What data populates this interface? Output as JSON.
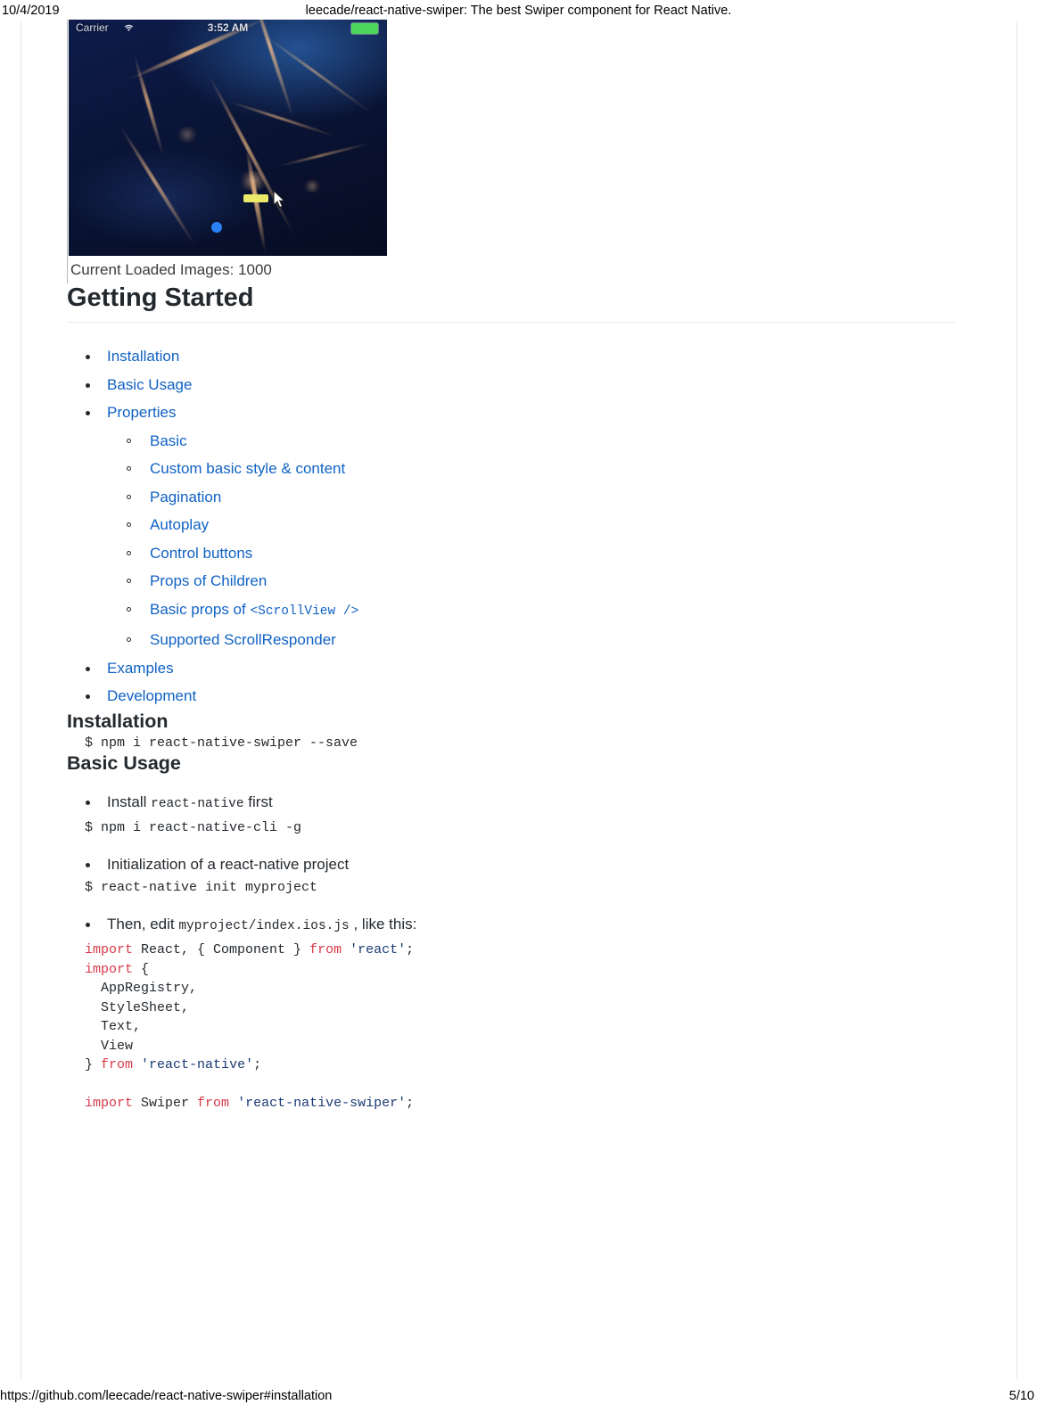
{
  "print": {
    "date": "10/4/2019",
    "document_title": "leecade/react-native-swiper: The best Swiper component for React Native.",
    "url": "https://github.com/leecade/react-native-swiper#installation",
    "page_number": "5/10"
  },
  "screenshot": {
    "status_bar": {
      "carrier": "Carrier",
      "wifi_icon": "wifi-icon",
      "time": "3:52 AM",
      "battery_icon": "battery-full-icon",
      "battery_color": "#4cd75a"
    },
    "caption": "Current Loaded Images: 1000",
    "pagination_dot_color": "#2b82f6"
  },
  "sections": {
    "getting_started": {
      "heading": "Getting Started",
      "toc": [
        {
          "label": "Installation"
        },
        {
          "label": "Basic Usage"
        },
        {
          "label": "Properties",
          "children": [
            {
              "label": "Basic"
            },
            {
              "label": "Custom basic style & content"
            },
            {
              "label": "Pagination"
            },
            {
              "label": "Autoplay"
            },
            {
              "label": "Control buttons"
            },
            {
              "label": "Props of Children"
            },
            {
              "label": "Basic props of ",
              "code": "<ScrollView />"
            },
            {
              "label": "Supported ScrollResponder"
            }
          ]
        },
        {
          "label": "Examples"
        },
        {
          "label": "Development"
        }
      ]
    },
    "installation": {
      "heading": "Installation",
      "command": "$ npm i react-native-swiper --save"
    },
    "basic_usage": {
      "heading": "Basic Usage",
      "steps": [
        {
          "before": "Install ",
          "code": "react-native",
          "after": " first"
        },
        {
          "before": "Initialization of a react-native project",
          "code": "",
          "after": ""
        },
        {
          "before": "Then, edit ",
          "code": "myproject/index.ios.js",
          "after": " , like this:"
        }
      ],
      "cmd_cli": "$ npm i react-native-cli -g",
      "cmd_init": "$ react-native init myproject",
      "js_lines": [
        [
          {
            "t": "import",
            "c": "kw"
          },
          {
            "t": " React, { Component } ",
            "c": ""
          },
          {
            "t": "from",
            "c": "kw"
          },
          {
            "t": " ",
            "c": ""
          },
          {
            "t": "'react'",
            "c": "str"
          },
          {
            "t": ";",
            "c": ""
          }
        ],
        [
          {
            "t": "import",
            "c": "kw"
          },
          {
            "t": " {",
            "c": ""
          }
        ],
        [
          {
            "t": "  AppRegistry,",
            "c": ""
          }
        ],
        [
          {
            "t": "  StyleSheet,",
            "c": ""
          }
        ],
        [
          {
            "t": "  Text,",
            "c": ""
          }
        ],
        [
          {
            "t": "  View",
            "c": ""
          }
        ],
        [
          {
            "t": "} ",
            "c": ""
          },
          {
            "t": "from",
            "c": "kw"
          },
          {
            "t": " ",
            "c": ""
          },
          {
            "t": "'react-native'",
            "c": "str"
          },
          {
            "t": ";",
            "c": ""
          }
        ],
        [
          {
            "t": "",
            "c": ""
          }
        ],
        [
          {
            "t": "import",
            "c": "kw"
          },
          {
            "t": " Swiper ",
            "c": ""
          },
          {
            "t": "from",
            "c": "kw"
          },
          {
            "t": " ",
            "c": ""
          },
          {
            "t": "'react-native-swiper'",
            "c": "str"
          },
          {
            "t": ";",
            "c": ""
          }
        ]
      ]
    }
  },
  "colors": {
    "link": "#1062c4",
    "text": "#24292e",
    "rule": "#eaecef",
    "code_keyword": "#d73a49",
    "code_string": "#1a3a73"
  }
}
